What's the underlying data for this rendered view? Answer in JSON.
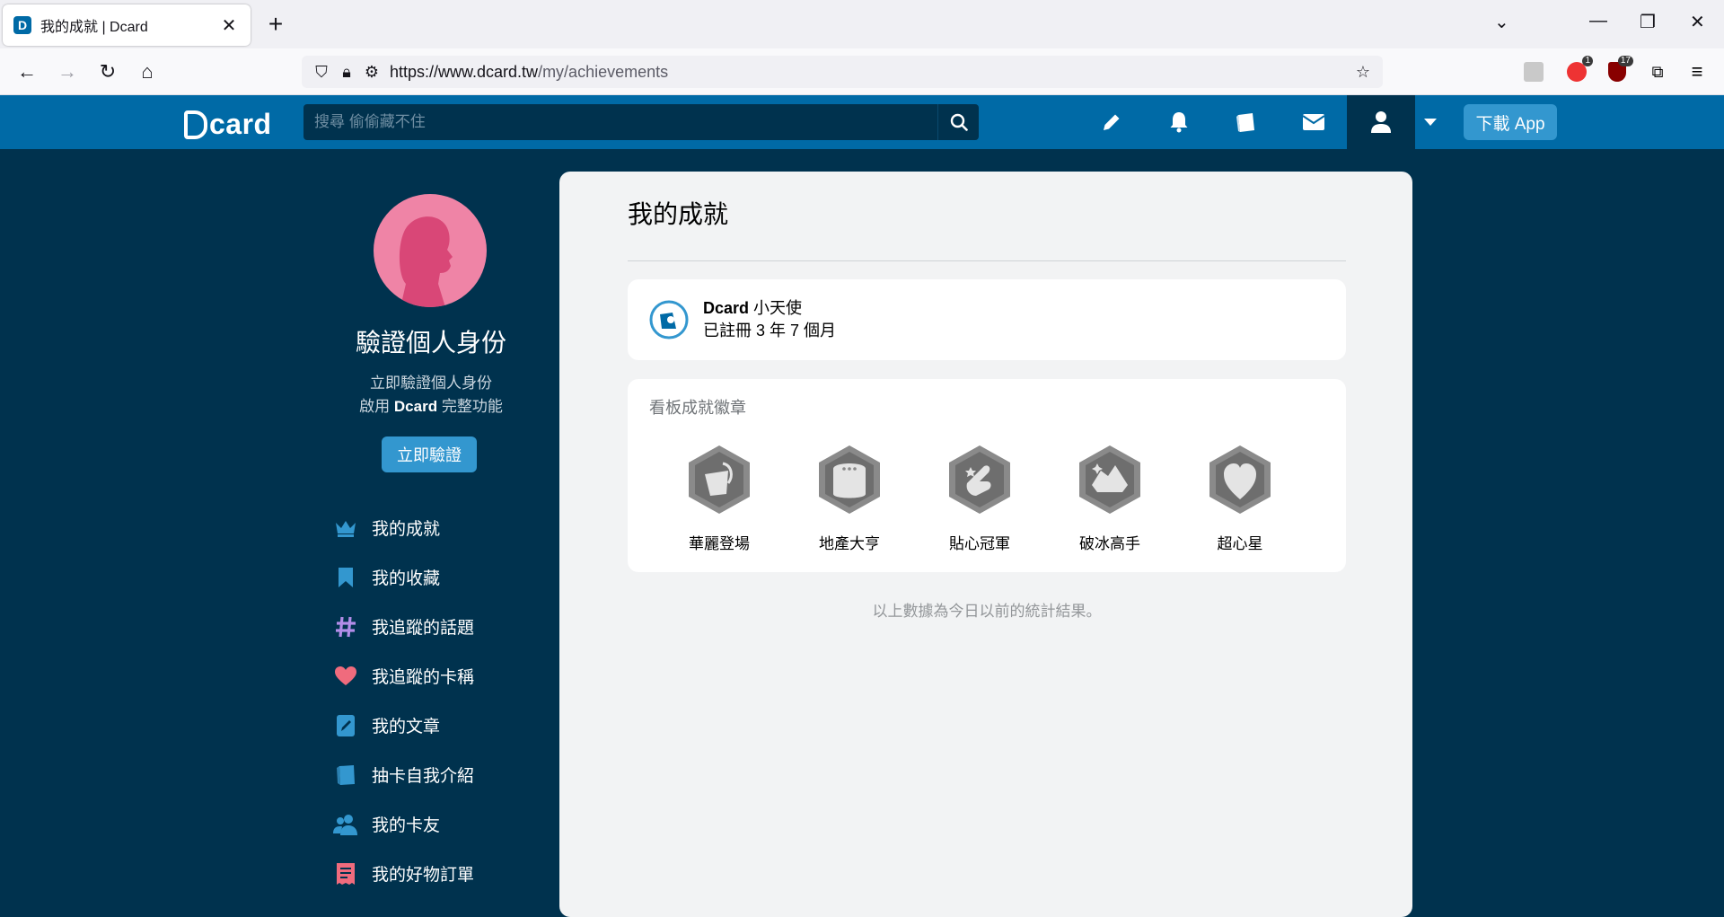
{
  "browser": {
    "tab_title": "我的成就 | Dcard",
    "url_host": "https://www.dcard.tw",
    "url_path": "/my/achievements",
    "ext_badge_1": "1",
    "ext_badge_2": "17"
  },
  "header": {
    "logo": "card",
    "search_placeholder": "搜尋 偷偷藏不住",
    "download_label": "下載 App"
  },
  "sidebar": {
    "verify_title": "驗證個人身份",
    "verify_line1": "立即驗證個人身份",
    "verify_line2_prefix": "啟用",
    "verify_line2_brand": "Dcard",
    "verify_line2_suffix": "完整功能",
    "verify_button": "立即驗證",
    "items": [
      {
        "label": "我的成就"
      },
      {
        "label": "我的收藏"
      },
      {
        "label": "我追蹤的話題"
      },
      {
        "label": "我追蹤的卡稱"
      },
      {
        "label": "我的文章"
      },
      {
        "label": "抽卡自我介紹"
      },
      {
        "label": "我的卡友"
      },
      {
        "label": "我的好物訂單"
      }
    ]
  },
  "main": {
    "title": "我的成就",
    "angel_brand": "Dcard",
    "angel_title": "小天使",
    "registered": "已註冊 3 年 7 個月",
    "badges_title": "看板成就徽章",
    "badges": [
      {
        "label": "華麗登場"
      },
      {
        "label": "地產大亨"
      },
      {
        "label": "貼心冠軍"
      },
      {
        "label": "破冰高手"
      },
      {
        "label": "超心星"
      }
    ],
    "footnote": "以上數據為今日以前的統計結果。"
  },
  "colors": {
    "header_blue": "#006aa6",
    "page_bg": "#00324e",
    "button_blue": "#3397cf"
  }
}
